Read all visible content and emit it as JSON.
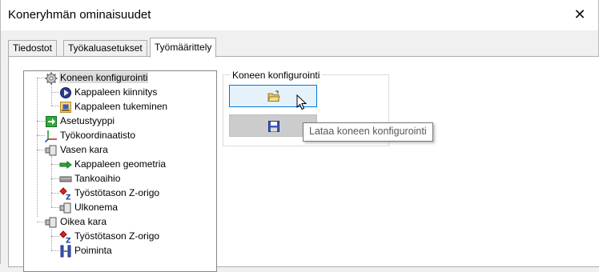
{
  "window": {
    "title": "Koneryhmän ominaisuudet",
    "close_glyph": "✕"
  },
  "tabs": [
    {
      "label": "Tiedostot",
      "active": false
    },
    {
      "label": "Työkaluasetukset",
      "active": false
    },
    {
      "label": "Työmäärittely",
      "active": true
    }
  ],
  "tree": {
    "items": [
      {
        "label": "Koneen konfigurointi",
        "icon": "gear-icon",
        "selected": true
      },
      {
        "label": "Kappaleen kiinnitys",
        "icon": "clamp-icon"
      },
      {
        "label": "Kappaleen tukeminen",
        "icon": "support-icon"
      },
      {
        "label": "Asetustyyppi",
        "icon": "setup-type-icon"
      },
      {
        "label": "Työkoordinaatisto",
        "icon": "coordinate-system-icon"
      },
      {
        "label": "Vasen kara",
        "icon": "spindle-icon"
      },
      {
        "label": "Kappaleen geometria",
        "icon": "geometry-icon"
      },
      {
        "label": "Tankoaihio",
        "icon": "bar-stock-icon"
      },
      {
        "label": "Työstötason Z-origo",
        "icon": "z-origin-icon"
      },
      {
        "label": "Ulkonema",
        "icon": "overhang-icon"
      },
      {
        "label": "Oikea kara",
        "icon": "spindle-icon"
      },
      {
        "label": "Työstötason Z-origo",
        "icon": "z-origin-icon"
      },
      {
        "label": "Poiminta",
        "icon": "pickup-icon"
      }
    ]
  },
  "group": {
    "title": "Koneen konfigurointi",
    "load_button_icon": "open-folder-icon",
    "save_button_icon": "floppy-disk-icon"
  },
  "tooltip": {
    "text": "Lataa koneen konfigurointi"
  }
}
